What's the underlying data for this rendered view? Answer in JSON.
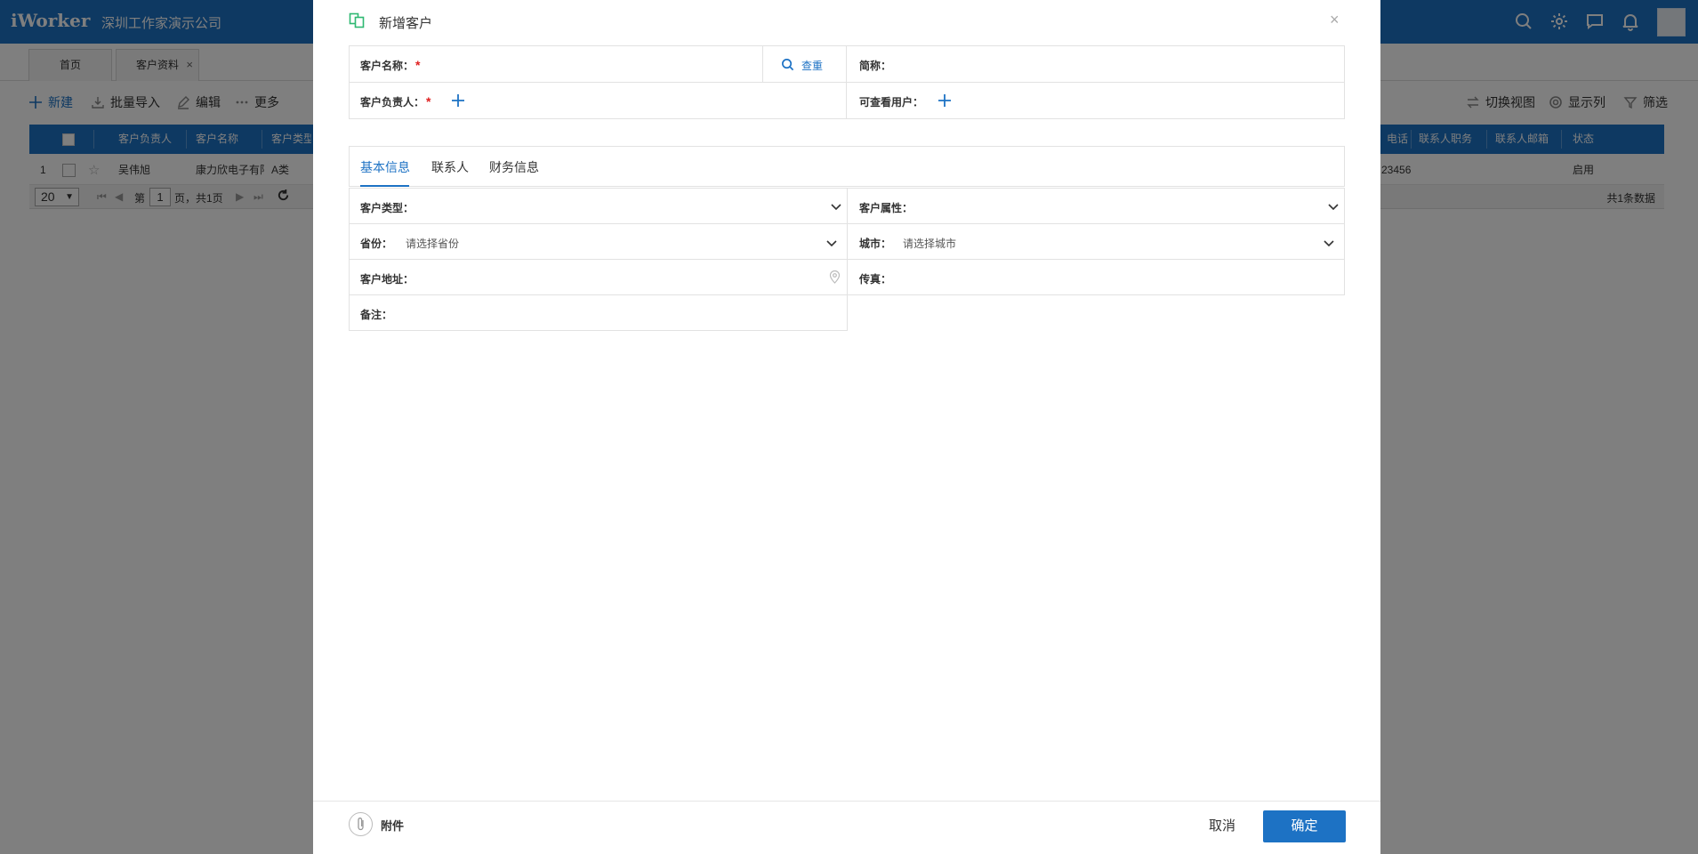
{
  "app": {
    "logo": "iWorker",
    "company": "深圳工作家演示公司"
  },
  "page_tabs": [
    {
      "label": "首页"
    },
    {
      "label": "客户资料",
      "close": "×"
    }
  ],
  "toolbar": {
    "new": "新建",
    "import": "批量导入",
    "edit": "编辑",
    "more": "更多",
    "switch_view": "切换视图",
    "show_columns": "显示列",
    "filter": "筛选"
  },
  "grid": {
    "headers": [
      "客户负责人",
      "客户名称",
      "客户类型",
      "电话",
      "联系人职务",
      "联系人邮箱",
      "状态"
    ],
    "row": {
      "index": "1",
      "owner": "吴伟旭",
      "name": "康力欣电子有限公司",
      "type": "A类",
      "phone": "23456",
      "status": "启用"
    },
    "pager": {
      "page_size": "20",
      "page_prefix": "第",
      "page": "1",
      "page_suffix": "页，共1页",
      "total": "共1条数据"
    }
  },
  "modal": {
    "title": "新增客户",
    "close": "×",
    "fields": {
      "customer_name_label": "客户名称：",
      "lookup": "查重",
      "short_name_label": "简称：",
      "owner_label": "客户负责人：",
      "viewers_label": "可查看用户：",
      "required_mark": "*"
    },
    "tabs": [
      {
        "label": "基本信息",
        "active": true
      },
      {
        "label": "联系人",
        "active": false
      },
      {
        "label": "财务信息",
        "active": false
      }
    ],
    "basic": {
      "customer_type_label": "客户类型：",
      "customer_attr_label": "客户属性：",
      "province_label": "省份：",
      "province_placeholder": "请选择省份",
      "city_label": "城市：",
      "city_placeholder": "请选择城市",
      "address_label": "客户地址：",
      "fax_label": "传真：",
      "remark_label": "备注："
    },
    "footer": {
      "attachment": "附件",
      "cancel": "取消",
      "confirm": "确定"
    }
  },
  "colors": {
    "primary": "#1d72c4",
    "required": "#e02020",
    "title_icon": "#2eb872"
  }
}
